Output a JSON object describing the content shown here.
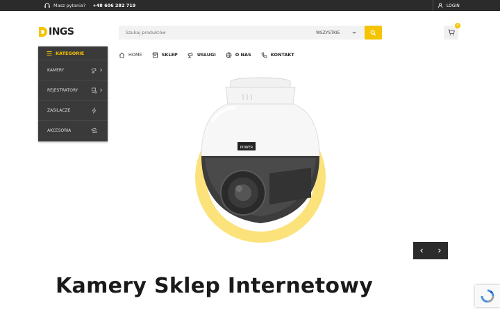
{
  "topbar": {
    "question": "Masz pytania?",
    "phone": "+48 606 282 719",
    "login": "LOGIN"
  },
  "logo": {
    "text": "INGS"
  },
  "search": {
    "placeholder": "Szukaj produktów",
    "category": "WSZYSTKIE"
  },
  "cart": {
    "count": "0"
  },
  "categories": {
    "header": "KATEGORIE",
    "items": [
      {
        "label": "KAMERY",
        "icon": "camera-icon"
      },
      {
        "label": "REJESTRATORY",
        "icon": "recorder-icon"
      },
      {
        "label": "ZASILACZE",
        "icon": "lightning-icon"
      },
      {
        "label": "AKCESORIA",
        "icon": "accessory-icon"
      }
    ]
  },
  "nav": {
    "items": [
      {
        "label": "HOME",
        "icon": "home-icon"
      },
      {
        "label": "SKLEP",
        "icon": "shop-icon"
      },
      {
        "label": "USŁUGI",
        "icon": "service-icon"
      },
      {
        "label": "O NAS",
        "icon": "globe-icon"
      },
      {
        "label": "KONTAKT",
        "icon": "phone-icon"
      }
    ]
  },
  "hero": {
    "brand_badge": "POWER"
  },
  "page_title": "Kamery Sklep Internetowy",
  "colors": {
    "accent": "#f5c400",
    "dark": "#2b2b2b",
    "panel": "#3a3a3a"
  }
}
